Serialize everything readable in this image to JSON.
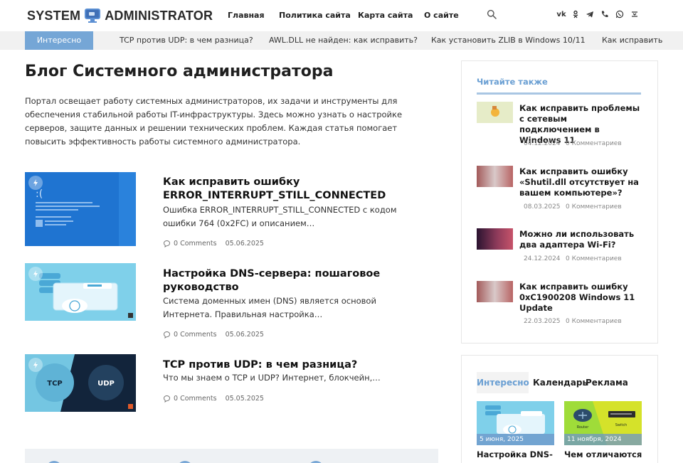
{
  "header": {
    "logo_left": "SYSTEM",
    "logo_right": "ADMINISTRATOR",
    "nav": [
      "Главная",
      "Политика сайта",
      "Карта сайта",
      "О сайте"
    ],
    "social": [
      "vk",
      "ok",
      "telegram",
      "phone",
      "whatsapp",
      "mail"
    ]
  },
  "ticker": {
    "badge": "Интересно",
    "items": [
      "TCP против UDP: в чем разница?",
      "AWL.DLL не найден: как исправить?",
      "Как установить ZLIB в Windows 10/11",
      "Как исправить"
    ]
  },
  "main": {
    "title": "Блог Системного администратора",
    "intro": "Портал освещает работу системных администраторов, их задачи и инструменты для обеспечения стабильной работы IT-инфраструктуры. Здесь можно узнать о настройке серверов, защите данных и решении технических проблем. Каждая статья помогает повысить эффективность работы системного администратора.",
    "posts": [
      {
        "title": "Как исправить ошибку ERROR_INTERRUPT_STILL_CONNECTED",
        "excerpt": "  Ошибка ERROR_INTERRUPT_STILL_CONNECTED с кодом ошибки 764 (0x2FC) и описанием…",
        "comments": "0 Comments",
        "date": "05.06.2025"
      },
      {
        "title": "Настройка DNS-сервера: пошаговое руководство",
        "excerpt": "  Система доменных имен (DNS) является основой Интернета. Правильная настройка…",
        "comments": "0 Comments",
        "date": "05.06.2025"
      },
      {
        "title": "TCP против UDP: в чем разница?",
        "excerpt": "  Что мы знаем о TCP и UDP? Интернет, блокчейн,…",
        "comments": "0 Comments",
        "date": "05.05.2025",
        "thumb_left": "TCP",
        "thumb_right": "UDP"
      }
    ]
  },
  "sidebar": {
    "heading": "Читайте также",
    "items": [
      {
        "title": "Как исправить проблемы с сетевым подключением в Windows 11",
        "date": "04.12.2024",
        "comments": "0 Комментариев"
      },
      {
        "title": "Как исправить ошибку «Shutil.dll отсутствует на вашем компьютере»?",
        "date": "08.03.2025",
        "comments": "0 Комментариев"
      },
      {
        "title": "Можно ли использовать два адаптера Wi-Fi?",
        "date": "24.12.2024",
        "comments": "0 Комментариев"
      },
      {
        "title": "Как исправить ошибку 0xC1900208 Windows 11 Update",
        "date": "22.03.2025",
        "comments": "0 Комментариев"
      }
    ],
    "tabs": [
      "Интересно",
      "Календарь",
      "Реклама"
    ],
    "cards": [
      {
        "date": "5 июня, 2025",
        "title": "Настройка DNS-"
      },
      {
        "date": "11 ноября, 2024",
        "title": "Чем отличаются",
        "label_a": "Router",
        "label_b": "Switch"
      }
    ]
  },
  "colors": {
    "accent": "#6a9fd3",
    "badge": "#75a6d6"
  }
}
